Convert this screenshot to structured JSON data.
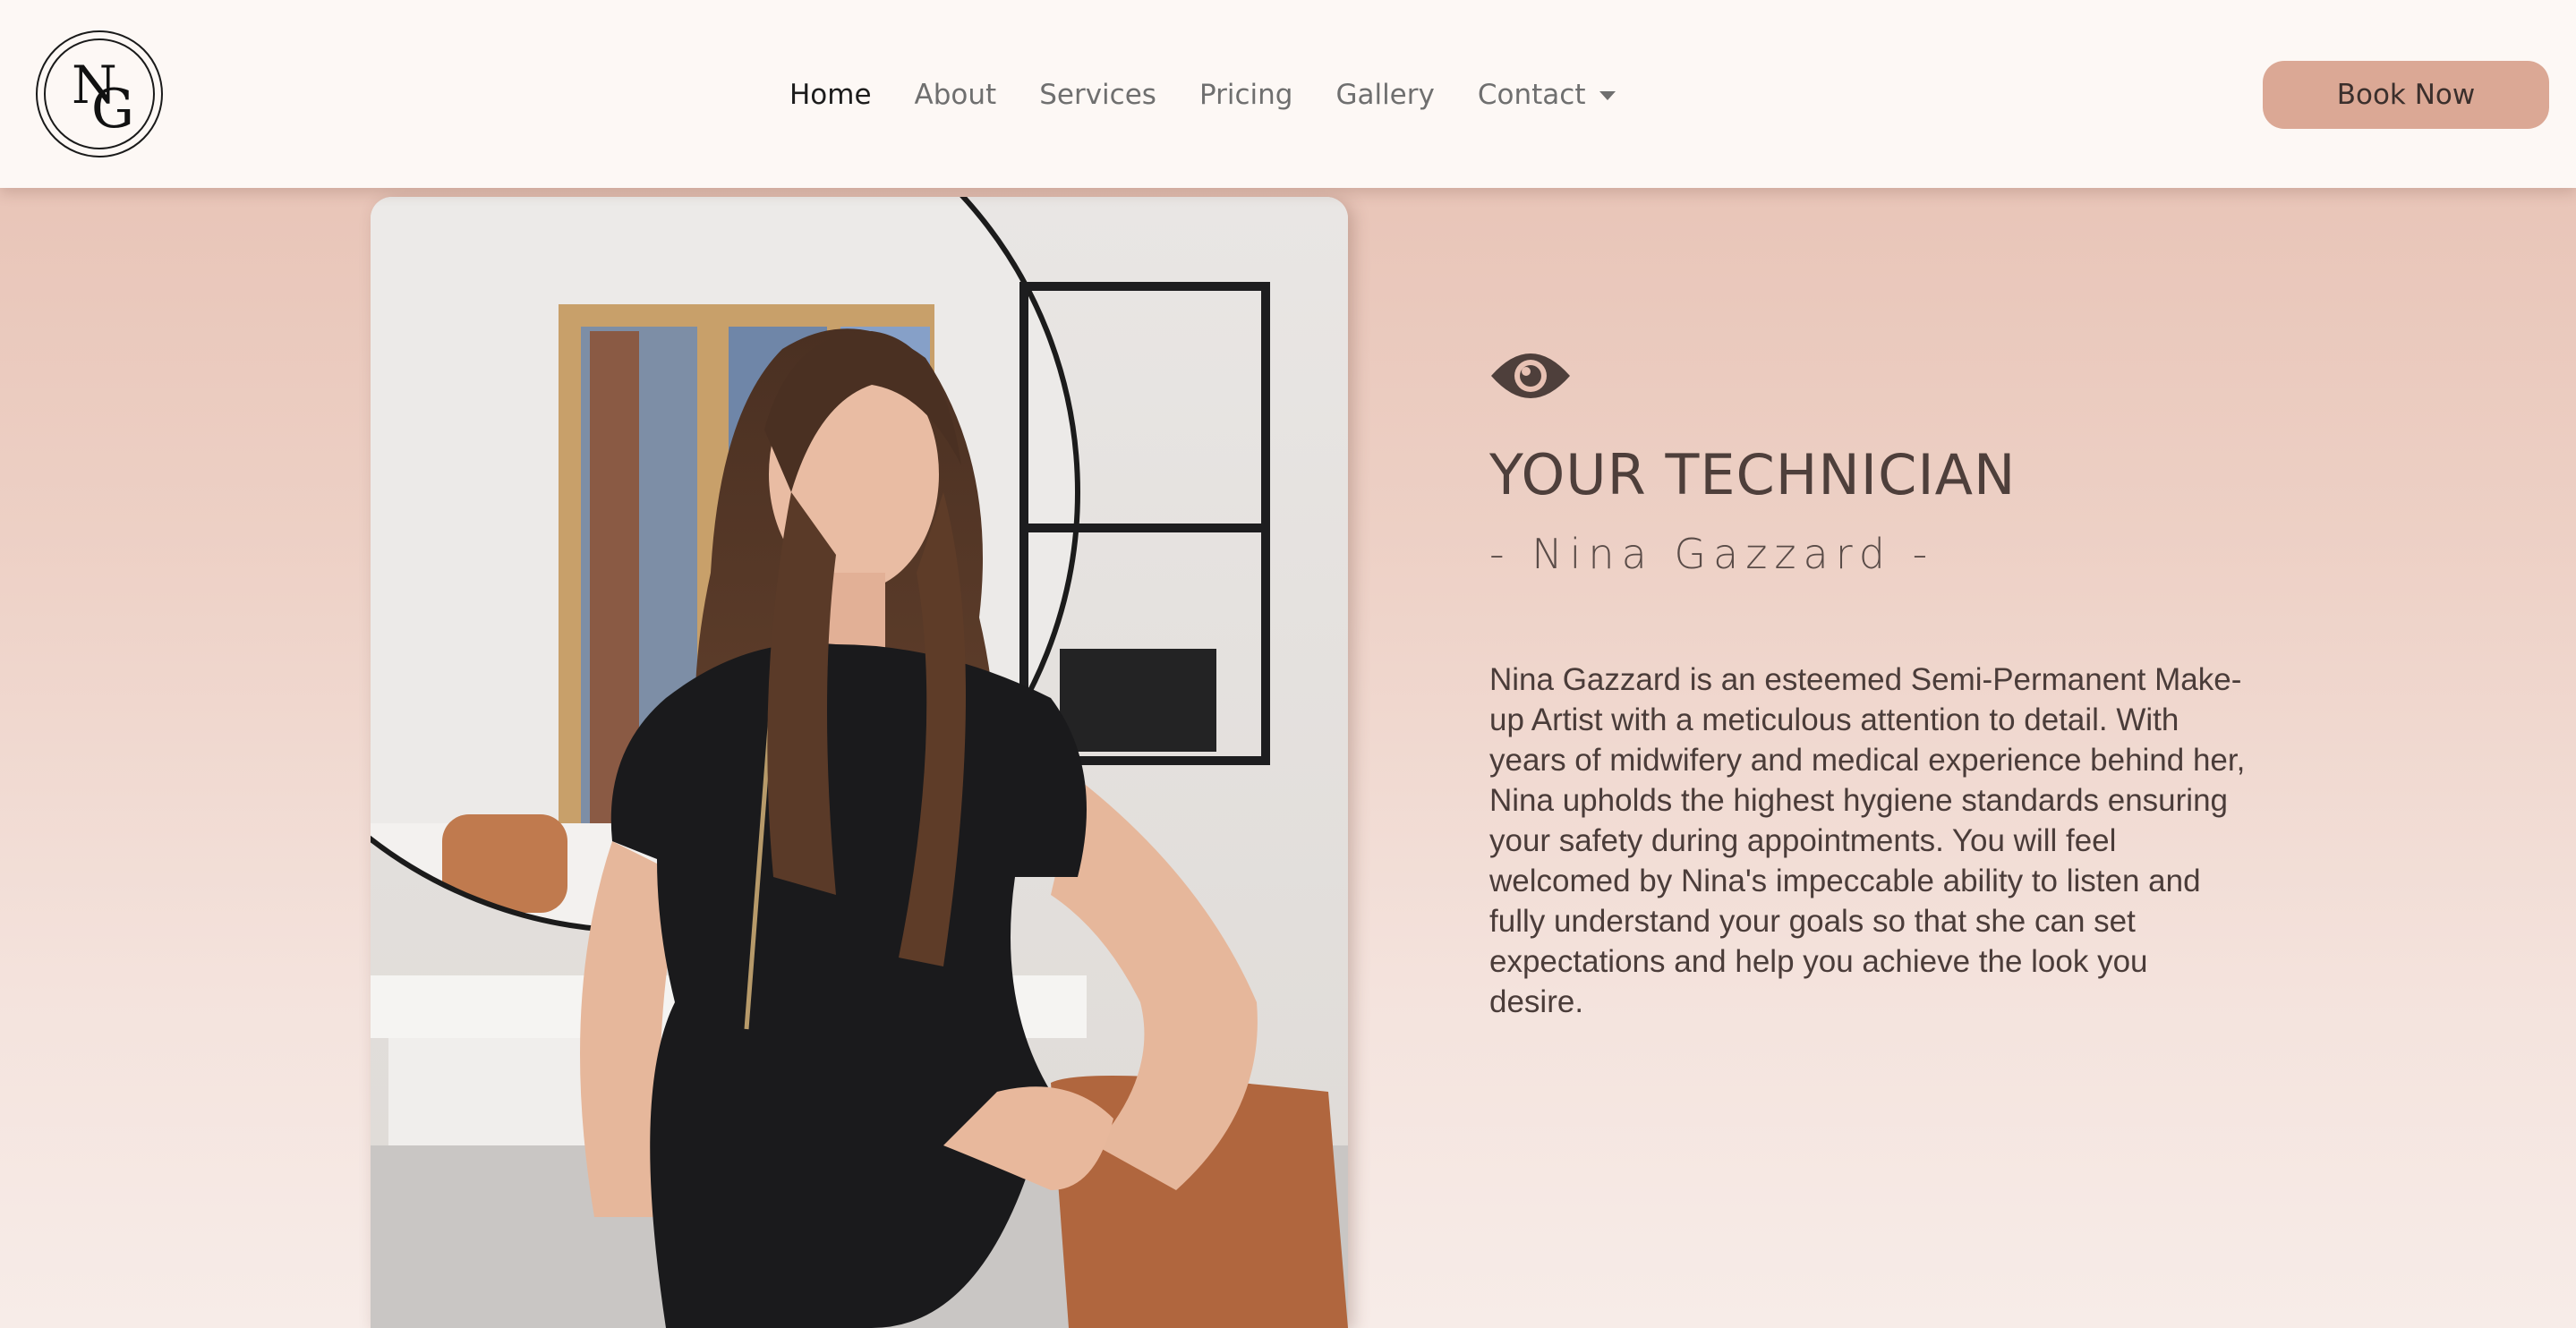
{
  "header": {
    "logo_letters": [
      "N",
      "G"
    ],
    "nav": [
      {
        "label": "Home",
        "active": true
      },
      {
        "label": "About",
        "active": false
      },
      {
        "label": "Services",
        "active": false
      },
      {
        "label": "Pricing",
        "active": false
      },
      {
        "label": "Gallery",
        "active": false
      },
      {
        "label": "Contact",
        "active": false,
        "dropdown": true
      }
    ],
    "book_button": "Book Now"
  },
  "hero": {
    "photo_subject": "technician-portrait",
    "icon": "eye-icon",
    "title": "YOUR TECHNICIAN",
    "subtitle": "- Nina Gazzard -",
    "bio": "Nina Gazzard is an esteemed Semi-Permanent Make-up Artist with a meticulous attention to detail. With years of midwifery and medical experience behind her, Nina upholds the highest hygiene standards ensuring your safety during appointments. You will feel welcomed by Nina's impeccable ability to listen and fully understand your goals so that she can set expectations and help you achieve the look you desire."
  },
  "colors": {
    "header_bg": "#fdf8f5",
    "accent": "#dba895",
    "heading": "#4e3f3b",
    "nav_inactive": "#6f6f6f",
    "nav_active": "#1c1c1c"
  }
}
